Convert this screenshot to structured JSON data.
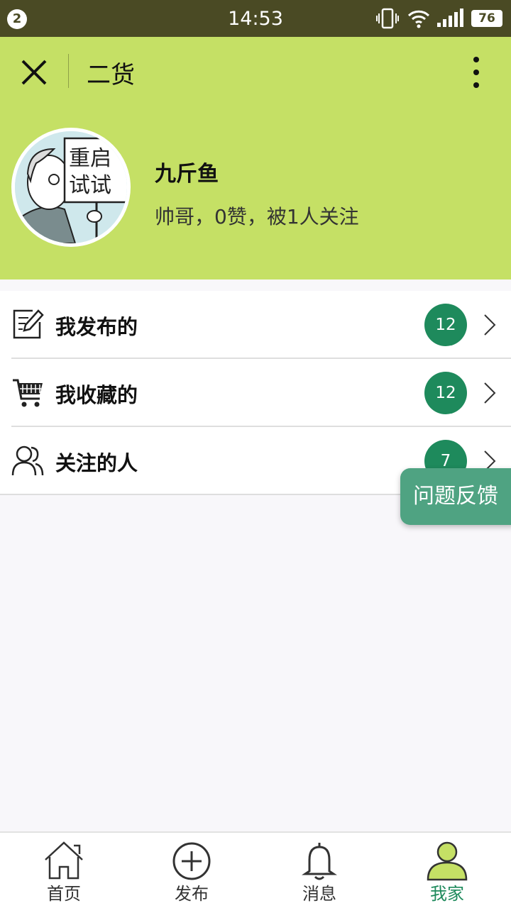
{
  "status_bar": {
    "notification_count": "2",
    "time": "14:53",
    "battery": "76",
    "icons": [
      "vibrate-icon",
      "wifi-icon",
      "signal-icon",
      "battery-icon"
    ]
  },
  "header": {
    "title": "二货",
    "close_icon": "close-icon",
    "more_icon": "more-vertical-icon",
    "background_color": "#c5e065"
  },
  "profile": {
    "name": "九斤鱼",
    "stats": "帅哥，0赞，被1人关注",
    "avatar_sign_text": "重启\n试试"
  },
  "menu": {
    "items": [
      {
        "label": "我发布的",
        "count": "12",
        "icon": "edit-note-icon"
      },
      {
        "label": "我收藏的",
        "count": "12",
        "icon": "cart-icon"
      },
      {
        "label": "关注的人",
        "count": "7",
        "icon": "users-icon"
      }
    ],
    "badge_color": "#1e8a5c"
  },
  "feedback_button": {
    "label": "问题反馈"
  },
  "bottom_nav": {
    "tabs": [
      {
        "label": "首页",
        "icon": "home-icon",
        "active": false
      },
      {
        "label": "发布",
        "icon": "add-circle-icon",
        "active": false
      },
      {
        "label": "消息",
        "icon": "bell-icon",
        "active": false
      },
      {
        "label": "我家",
        "icon": "user-icon",
        "active": true
      }
    ],
    "active_color": "#1e8a5c"
  }
}
